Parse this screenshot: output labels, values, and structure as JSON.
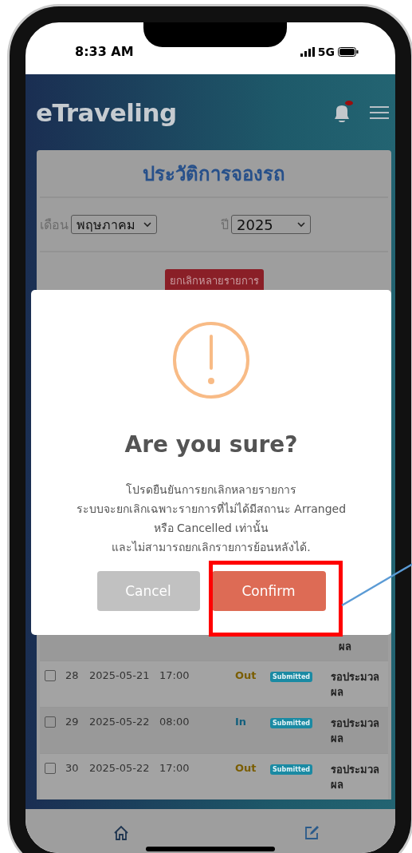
{
  "status_bar": {
    "time": "8:33 AM",
    "network": "5G"
  },
  "header": {
    "logo": "eTraveling",
    "notification_unread": true
  },
  "card": {
    "title": "ประวัติการจองรถ",
    "filters": [
      {
        "label": "เดือน",
        "value": "พฤษภาคม"
      },
      {
        "label": "ปี",
        "value": "2025"
      }
    ],
    "bulk_cancel_button": "ยกเลิกหลายรายการ"
  },
  "table": {
    "partial_row": {
      "status_text": "ผล"
    },
    "rows": [
      {
        "checked": false,
        "no": "28",
        "date": "2025-05-21",
        "time": "17:00",
        "direction": "Out",
        "kind": "out",
        "badge": "Submitted",
        "status_text": "รอประมวลผล"
      },
      {
        "checked": false,
        "no": "29",
        "date": "2025-05-22",
        "time": "08:00",
        "direction": "In",
        "kind": "in",
        "badge": "Submitted",
        "status_text": "รอประมวลผล"
      },
      {
        "checked": false,
        "no": "30",
        "date": "2025-05-22",
        "time": "17:00",
        "direction": "Out",
        "kind": "out",
        "badge": "Submitted",
        "status_text": "รอประมวลผล"
      }
    ]
  },
  "dialog": {
    "title": "Are you sure?",
    "message_lines": [
      "โปรดยืนยันการยกเลิกหลายรายการ",
      "ระบบจะยกเลิกเฉพาะรายการที่ไม่ได้มีสถานะ Arranged",
      "หรือ Cancelled เท่านั้น",
      "และไม่สามารถยกเลิกรายการย้อนหลังได้."
    ],
    "buttons": [
      {
        "label": "Cancel",
        "kind": "cancel"
      },
      {
        "label": "Confirm",
        "kind": "confirm",
        "highlighted": true
      }
    ]
  }
}
